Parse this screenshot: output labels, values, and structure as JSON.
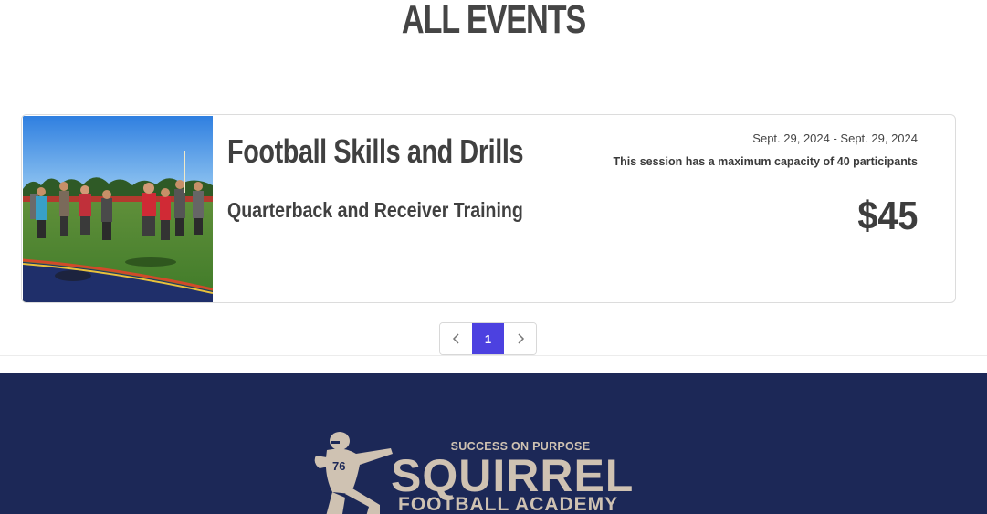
{
  "page": {
    "title": "ALL EVENTS"
  },
  "event": {
    "title": "Football Skills and Drills",
    "subtitle": "Quarterback and Receiver Training",
    "dates": "Sept. 29, 2024 - Sept. 29, 2024",
    "capacity": "This session has a maximum capacity of 40 participants",
    "price": "$45",
    "image_alt": "Players on a football field"
  },
  "pagination": {
    "prev_icon": "chevron-left-icon",
    "next_icon": "chevron-right-icon",
    "current_page": "1",
    "active_color": "#4c41e0"
  },
  "footer": {
    "background": "#1c2857",
    "logo": {
      "tagline": "SUCCESS ON PURPOSE",
      "name": "SQUIRREL",
      "sub": "FOOTBALL ACADEMY",
      "jersey_number": "76",
      "color": "#cfc2b2"
    }
  }
}
